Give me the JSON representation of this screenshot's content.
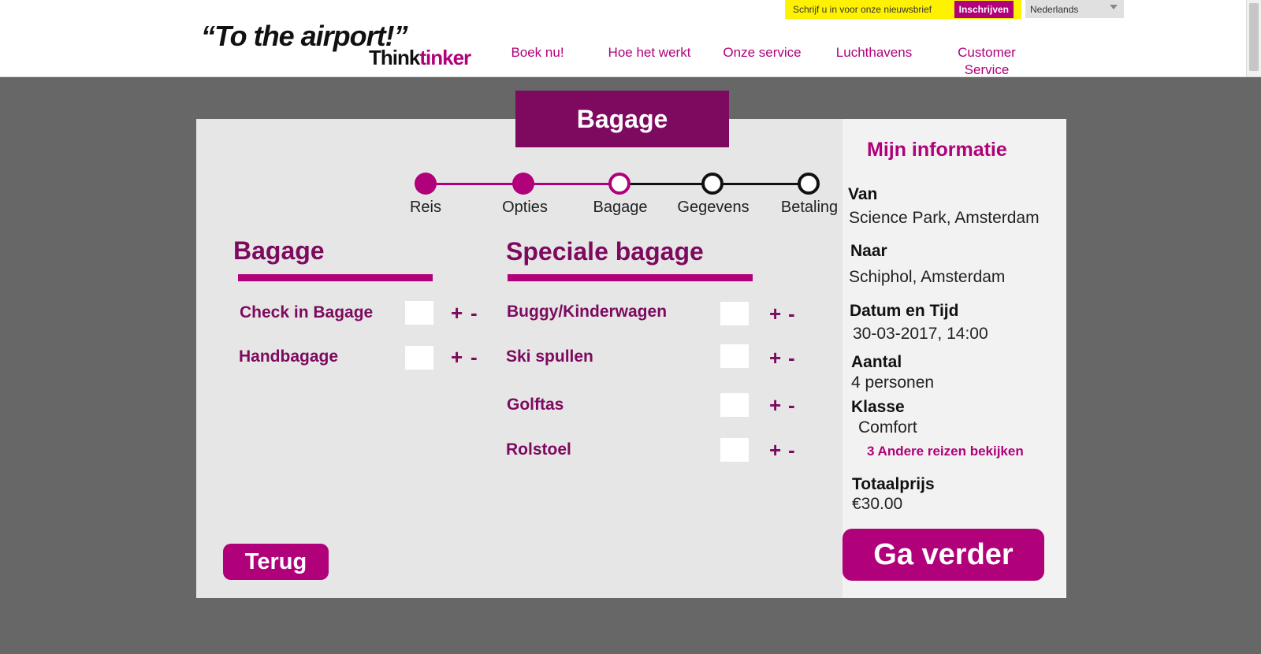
{
  "header": {
    "logo": {
      "line1": "“To the airport!”",
      "think": "Think",
      "tinker": "tinker"
    },
    "newsletter": {
      "text": "Schrijf u in voor onze nieuwsbrief",
      "button": "Inschrijven"
    },
    "language": {
      "selected": "Nederlands"
    },
    "nav": [
      {
        "label": "Boek nu!"
      },
      {
        "label": "Hoe het werkt"
      },
      {
        "label": "Onze service"
      },
      {
        "label": "Luchthavens"
      },
      {
        "label": "Customer\nService"
      }
    ]
  },
  "page": {
    "title": "Bagage"
  },
  "steps": [
    {
      "label": "Reis",
      "state": "done"
    },
    {
      "label": "Opties",
      "state": "done"
    },
    {
      "label": "Bagage",
      "state": "current"
    },
    {
      "label": "Gegevens",
      "state": "todo"
    },
    {
      "label": "Betaling",
      "state": "todo"
    }
  ],
  "baggage": {
    "title": "Bagage",
    "items": [
      {
        "label": "Check in Bagage",
        "plus": "+",
        "minus": "-"
      },
      {
        "label": "Handbagage",
        "plus": "+",
        "minus": "-"
      }
    ]
  },
  "special_baggage": {
    "title": "Speciale bagage",
    "items": [
      {
        "label": "Buggy/Kinderwagen",
        "plus": "+",
        "minus": "-"
      },
      {
        "label": "Ski spullen",
        "plus": "+",
        "minus": "-"
      },
      {
        "label": "Golftas",
        "plus": "+",
        "minus": "-"
      },
      {
        "label": "Rolstoel",
        "plus": "+",
        "minus": "-"
      }
    ]
  },
  "info": {
    "title": "Mijn informatie",
    "van_label": "Van",
    "van_value": "Science Park, Amsterdam",
    "naar_label": "Naar",
    "naar_value": "Schiphol, Amsterdam",
    "datum_label": "Datum en Tijd",
    "datum_value": "30-03-2017, 14:00",
    "aantal_label": "Aantal",
    "aantal_value": "4 personen",
    "klasse_label": "Klasse",
    "klasse_value": "Comfort",
    "link": "3 Andere reizen bekijken",
    "totaal_label": "Totaalprijs",
    "totaal_value": "€30.00"
  },
  "buttons": {
    "back": "Terug",
    "next": "Ga verder"
  },
  "colors": {
    "accent": "#b0007a",
    "dark_accent": "#7d0a5e",
    "background": "#676767",
    "newsletter": "#fff200"
  }
}
